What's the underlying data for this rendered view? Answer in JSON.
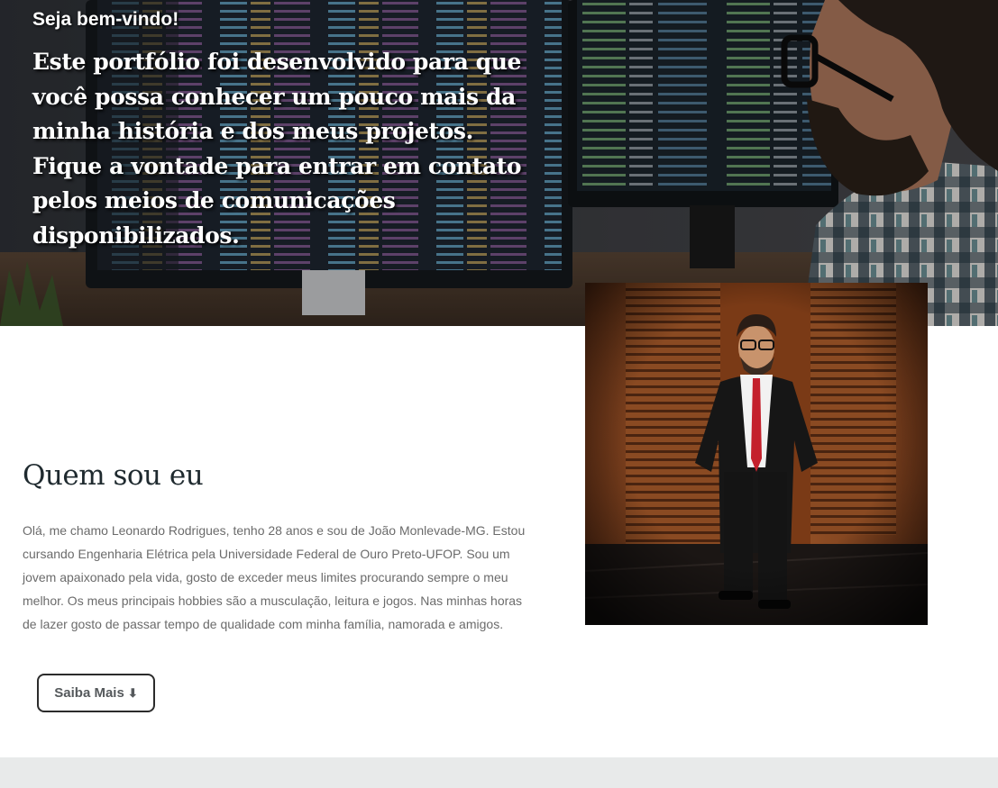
{
  "hero": {
    "greeting": "Seja bem-vindo!",
    "intro": "Este portfólio foi desenvolvido para que você possa conhecer um pouco mais da minha história e dos meus projetos. Fique a vontade para entrar em contato pelos meios de comunicações disponibilizados."
  },
  "about": {
    "title": "Quem sou eu",
    "text": "Olá, me chamo Leonardo Rodrigues, tenho 28 anos e sou de João Monlevade-MG. Estou cursando Engenharia Elétrica pela Universidade Federal de Ouro Preto-UFOP. Sou um jovem apaixonado pela vida, gosto de exceder meus limites procurando sempre o meu melhor. Os meus principais hobbies são a musculação, leitura e jogos. Nas minhas horas de lazer gosto de passar tempo de qualidade com minha família, namorada e amigos.",
    "button_label": "Saiba Mais",
    "button_icon": "down-arrow-icon"
  },
  "colors": {
    "title": "#1f2a2f",
    "body_text": "#6b6b6b",
    "button_border": "#2b2b2b",
    "footer_band": "#e8eaea"
  }
}
